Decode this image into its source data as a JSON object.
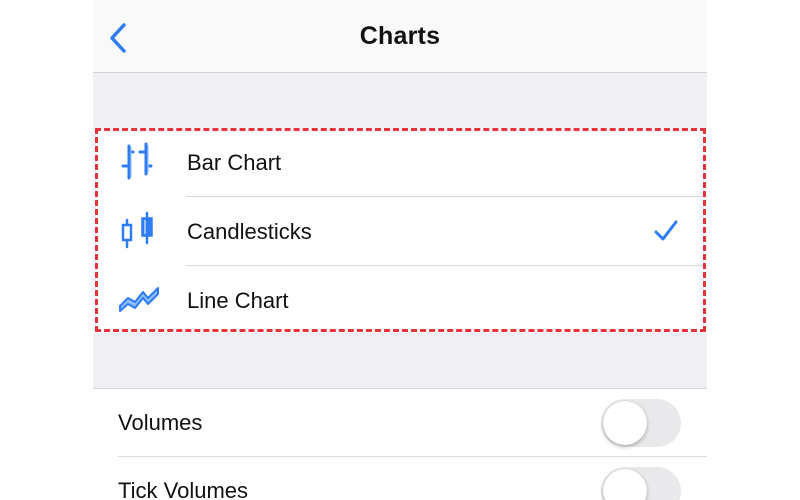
{
  "navbar": {
    "title": "Charts",
    "back_icon": "chevron-left-icon"
  },
  "colors": {
    "accent": "#2f7df6",
    "highlight": "#e8333a",
    "group_background": "#efeff4"
  },
  "chart_types": {
    "items": [
      {
        "label": "Bar Chart",
        "icon": "bar-chart-icon",
        "selected": false
      },
      {
        "label": "Candlesticks",
        "icon": "candlesticks-icon",
        "selected": true
      },
      {
        "label": "Line Chart",
        "icon": "line-chart-icon",
        "selected": false
      }
    ],
    "selected_icon": "checkmark-icon"
  },
  "toggles": {
    "items": [
      {
        "label": "Volumes",
        "on": false
      },
      {
        "label": "Tick Volumes",
        "on": false
      }
    ]
  }
}
